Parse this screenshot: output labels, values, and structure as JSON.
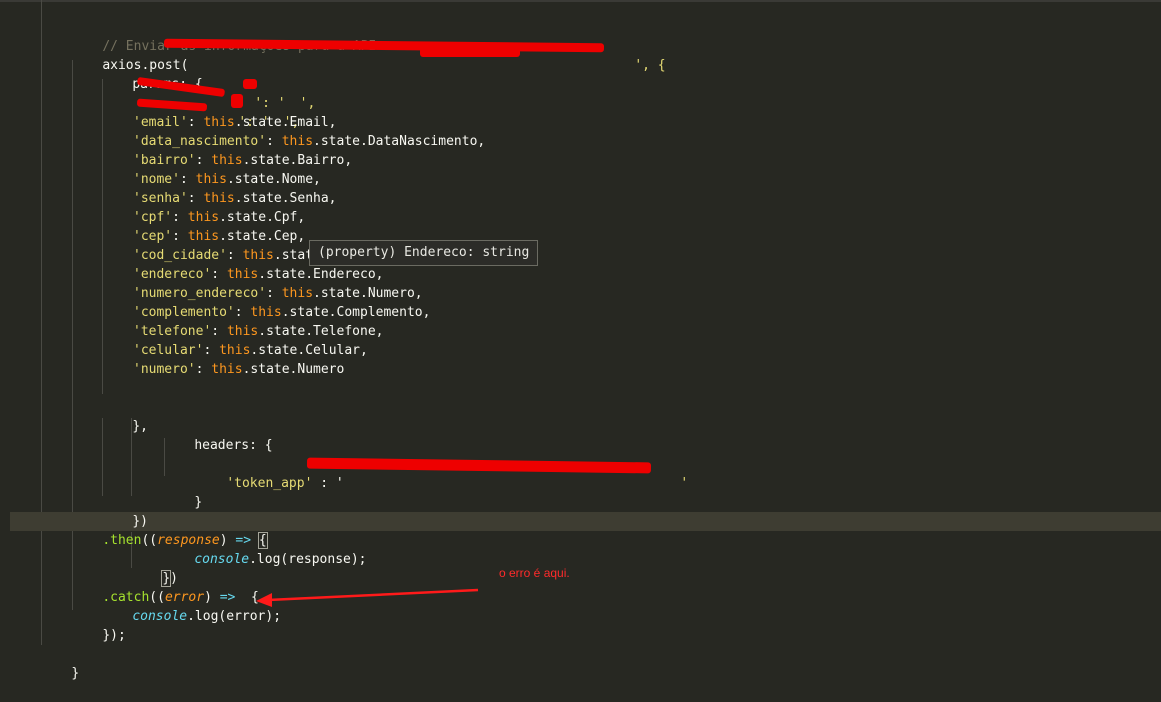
{
  "code": {
    "comment": "// Enviar as informações para a API",
    "axios_post": "axios.post(",
    "post_url_tail": "', {",
    "params_key": "params: {",
    "blank_value_1": "': '",
    "blank_value_1_end": "',",
    "blank_value_2": "': '",
    "blank_value_2_end": "',",
    "fields": [
      {
        "key": "'email'",
        "value": "this",
        "rest": ".state.Email,"
      },
      {
        "key": "'data_nascimento'",
        "value": "this",
        "rest": ".state.DataNascimento,"
      },
      {
        "key": "'bairro'",
        "value": "this",
        "rest": ".state.Bairro,"
      },
      {
        "key": "'nome'",
        "value": "this",
        "rest": ".state.Nome,"
      },
      {
        "key": "'senha'",
        "value": "this",
        "rest": ".state.Senha,"
      },
      {
        "key": "'cpf'",
        "value": "this",
        "rest": ".state.Cpf,"
      },
      {
        "key": "'cep'",
        "value": "this",
        "rest": ".state.Cep,"
      },
      {
        "key": "'cod_cidade'",
        "value": "this",
        "rest": ".stat"
      },
      {
        "key": "'endereco'",
        "value": "this",
        "rest": ".state.Endereco,"
      },
      {
        "key": "'numero_endereco'",
        "value": "this",
        "rest": ".state.Numero,"
      },
      {
        "key": "'complemento'",
        "value": "this",
        "rest": ".state.Complemento,"
      },
      {
        "key": "'telefone'",
        "value": "this",
        "rest": ".state.Telefone,"
      },
      {
        "key": "'celular'",
        "value": "this",
        "rest": ".state.Celular,"
      },
      {
        "key": "'numero'",
        "value": "this",
        "rest": ".state.Numero"
      }
    ],
    "params_close": "},",
    "headers_key": "headers: {",
    "token_key": "'token_app'",
    "token_sep": " : '",
    "token_end": "'",
    "headers_close": "}",
    "post_close": "})",
    "then_prefix": ".then",
    "then_open": "((",
    "then_param": "response",
    "then_close": ") ",
    "arrow": "=>",
    "then_brace": "{",
    "console_word": "console",
    "log_call_then": ".log(response);",
    "then_end_open": "}",
    "then_end_close": ")",
    "catch_prefix": ".catch",
    "catch_open": "((",
    "catch_param": "error",
    "catch_close": ") ",
    "catch_brace": "  {",
    "log_call_catch": ".log(error);",
    "chain_close": "});",
    "final_close": "}"
  },
  "tooltip": "(property) Endereco: string",
  "annotation": "o erro é aqui.",
  "colors": {
    "background": "#272822",
    "comment": "#75715e",
    "function": "#a6e22e",
    "keyword": "#fd971f",
    "string": "#e6db74",
    "annotation": "#ff2b2b"
  }
}
